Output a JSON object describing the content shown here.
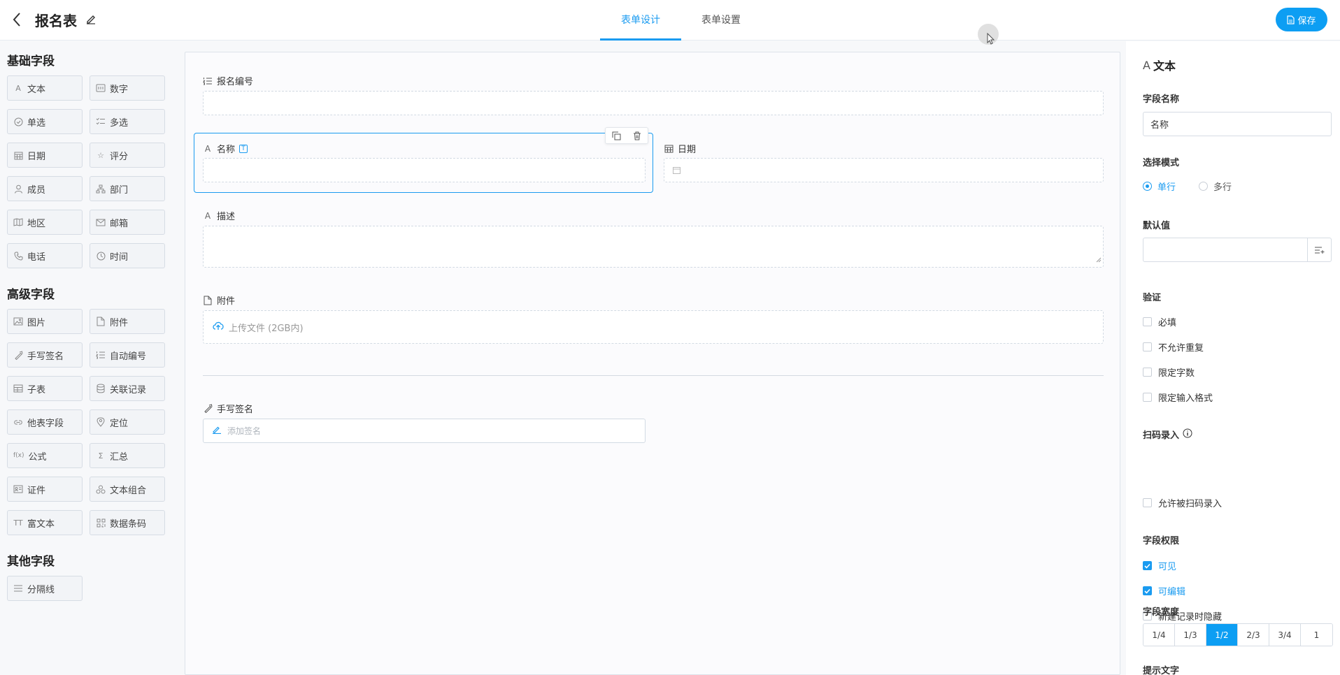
{
  "header": {
    "title": "报名表",
    "tabs": [
      "表单设计",
      "表单设置"
    ],
    "save_label": "保存"
  },
  "left": {
    "groups": [
      {
        "title": "基础字段"
      },
      {
        "title": "高级字段"
      },
      {
        "title": "其他字段"
      }
    ],
    "basic": [
      "文本",
      "数字",
      "单选",
      "多选",
      "日期",
      "评分",
      "成员",
      "部门",
      "地区",
      "邮箱",
      "电话",
      "时间"
    ],
    "advanced": [
      "图片",
      "附件",
      "手写签名",
      "自动编号",
      "子表",
      "关联记录",
      "他表字段",
      "定位",
      "公式",
      "汇总",
      "证件",
      "文本组合",
      "富文本",
      "数据条码"
    ],
    "other": [
      "分隔线"
    ],
    "formula_icon": "f(x)",
    "richtext_icon": "TT"
  },
  "canvas": {
    "fields": {
      "serial": "报名编号",
      "name": "名称",
      "date": "日期",
      "desc": "描述",
      "attachment": "附件",
      "upload_hint": "上传文件 (2GB内)",
      "signature": "手写签名",
      "sign_hint": "添加签名"
    }
  },
  "props": {
    "title": "文本",
    "field_name_label": "字段名称",
    "field_name_value": "名称",
    "mode_label": "选择模式",
    "mode_single": "单行",
    "mode_multi": "多行",
    "mode_selected": "single",
    "default_label": "默认值",
    "validation_label": "验证",
    "validation": [
      "必填",
      "不允许重复",
      "限定字数",
      "限定输入格式"
    ],
    "scan_label": "扫码录入",
    "scan_option": "允许被扫码录入",
    "perm_label": "字段权限",
    "perms": [
      {
        "label": "可见",
        "checked": true
      },
      {
        "label": "可编辑",
        "checked": true
      },
      {
        "label": "新建记录时隐藏",
        "checked": false
      }
    ],
    "width_label": "字段宽度",
    "widths": [
      "1/4",
      "1/3",
      "1/2",
      "2/3",
      "3/4",
      "1"
    ],
    "width_selected": "1/2",
    "hint_label": "提示文字"
  },
  "colors": {
    "accent": "#1a9bf0",
    "save": "#0d9ef3"
  }
}
